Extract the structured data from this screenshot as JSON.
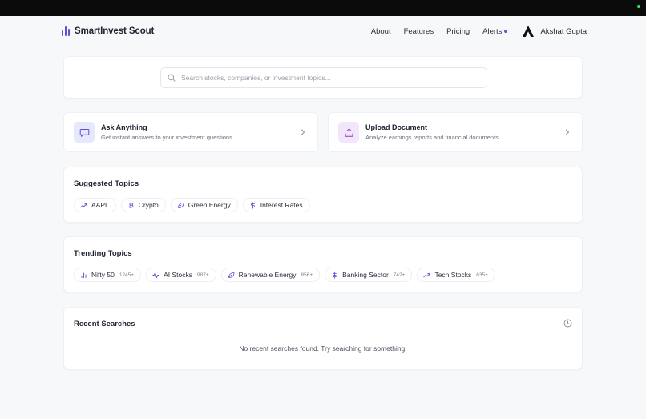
{
  "colors": {
    "accent": "#5b50d6",
    "alert_dot": "#5b5bdc",
    "ask_icon_bg": "#e6e8fb",
    "upload_icon_bg": "#f2e6fa"
  },
  "brand": {
    "name": "SmartInvest Scout",
    "icon": "bar-chart-icon"
  },
  "nav": {
    "links": [
      "About",
      "Features",
      "Pricing",
      "Alerts"
    ],
    "user_name": "Akshat Gupta",
    "avatar_icon": "a-logo-icon"
  },
  "search": {
    "placeholder": "Search stocks, companies, or investment topics...",
    "value": "",
    "icon": "search-icon"
  },
  "actions": [
    {
      "title": "Ask Anything",
      "description": "Get instant answers to your investment questions",
      "icon": "chat-icon"
    },
    {
      "title": "Upload Document",
      "description": "Analyze earnings reports and financial documents",
      "icon": "upload-icon"
    }
  ],
  "suggested": {
    "title": "Suggested Topics",
    "items": [
      {
        "label": "AAPL",
        "icon": "trending-up-icon"
      },
      {
        "label": "Crypto",
        "icon": "bitcoin-icon"
      },
      {
        "label": "Green Energy",
        "icon": "leaf-icon"
      },
      {
        "label": "Interest Rates",
        "icon": "dollar-icon"
      }
    ]
  },
  "trending": {
    "title": "Trending Topics",
    "items": [
      {
        "label": "Nifty 50",
        "count": "1245+",
        "icon": "bar-chart-icon"
      },
      {
        "label": "AI Stocks",
        "count": "987+",
        "icon": "activity-icon"
      },
      {
        "label": "Renewable Energy",
        "count": "856+",
        "icon": "leaf-icon"
      },
      {
        "label": "Banking Sector",
        "count": "742+",
        "icon": "dollar-icon"
      },
      {
        "label": "Tech Stocks",
        "count": "635+",
        "icon": "trending-up-icon"
      }
    ]
  },
  "recent": {
    "title": "Recent Searches",
    "empty_message": "No recent searches found. Try searching for something!",
    "icon": "clock-icon"
  }
}
